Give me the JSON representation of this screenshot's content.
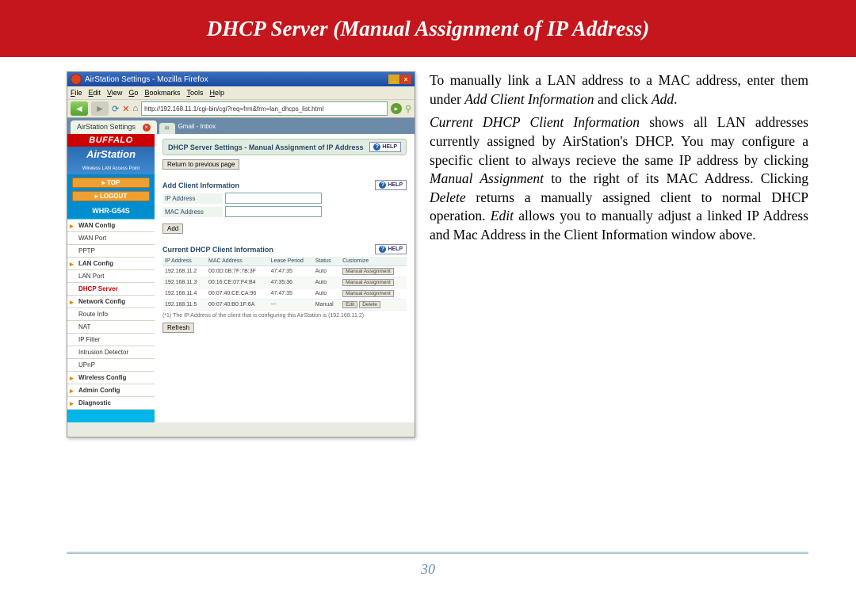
{
  "header": {
    "title": "DHCP Server (Manual Assignment of IP Address)"
  },
  "page_number": "30",
  "instructions": {
    "p1_pre": "To manually link a LAN address to a MAC address, enter them under ",
    "p1_em": "Add Client Information",
    "p1_mid": " and click ",
    "p1_em2": "Add",
    "p1_end": ".",
    "p2_em1": "Current DHCP Client Information",
    "p2_a": " shows all LAN addresses currently assigned by AirStation's DHCP.  You may configure a specific client to always recieve the same IP address by clicking ",
    "p2_em2": "Manual Assignment",
    "p2_b": " to the right of its MAC Address.  Clicking ",
    "p2_em3": "Delete",
    "p2_c": " returns a manually assigned client to normal DHCP operation.  ",
    "p2_em4": "Edit",
    "p2_d": " allows you to manually adjust a linked IP Address and Mac Address in the Client Information window above."
  },
  "screenshot": {
    "window_title": "AirStation Settings - Mozilla Firefox",
    "menu": [
      "File",
      "Edit",
      "View",
      "Go",
      "Bookmarks",
      "Tools",
      "Help"
    ],
    "url": "http://192.168.11.1/cgi-bin/cgi?req=frm&frm=lan_dhcps_list.html",
    "tab": "AirStation Settings",
    "newtab": "Gmail - Inbox",
    "brand": "BUFFALO",
    "brand2": "AirStation",
    "brand2_sub": "Wireless LAN Access Point",
    "top_btn": "▸ TOP",
    "logout_btn": "▸ LOGOUT",
    "model": "WHR-G54S",
    "nav": {
      "wan": "WAN Config",
      "wanport": "WAN Port",
      "pptp": "PPTP",
      "lan": "LAN Config",
      "lanport": "LAN Port",
      "dhcp": "DHCP Server",
      "network": "Network Config",
      "route": "Route Info",
      "nat": "NAT",
      "ipfilter": "IP Filter",
      "intrusion": "Intrusion Detector",
      "upnp": "UPnP",
      "wireless": "Wireless Config",
      "admin": "Admin Config",
      "diag": "Diagnostic"
    },
    "panel_title": "DHCP Server Settings - Manual Assignment of IP Address",
    "help": "HELP",
    "return_btn": "Return to previous page",
    "add_section": "Add Client Information",
    "ip_label": "IP Address",
    "mac_label": "MAC Address",
    "add_btn": "Add",
    "current_section": "Current DHCP Client Information",
    "columns": {
      "ip": "IP Address",
      "mac": "MAC Address",
      "lease": "Lease Period",
      "status": "Status",
      "customize": "Customize"
    },
    "rows": [
      {
        "ip": "192.168.11.2",
        "mac": "00:0D:0B:7F:7B:3F",
        "lease": "47:47:35",
        "status": "Auto",
        "btn": "Manual Assignment"
      },
      {
        "ip": "192.168.11.3",
        "mac": "00:16:CE:07:F4:B4",
        "lease": "47:35:36",
        "status": "Auto",
        "btn": "Manual Assignment"
      },
      {
        "ip": "192.168.11.4",
        "mac": "00:07:40:CE:CA:96",
        "lease": "47:47:35",
        "status": "Auto",
        "btn": "Manual Assignment"
      },
      {
        "ip": "192.168.11.5",
        "mac": "00:07:40:B0:1F:6A",
        "lease": "---",
        "status": "Manual",
        "btn1": "Edit",
        "btn2": "Delete"
      }
    ],
    "footnote": "(*1) The IP Address of the client that is configuring this AirStation is (192.168.11.2)",
    "refresh": "Refresh"
  }
}
